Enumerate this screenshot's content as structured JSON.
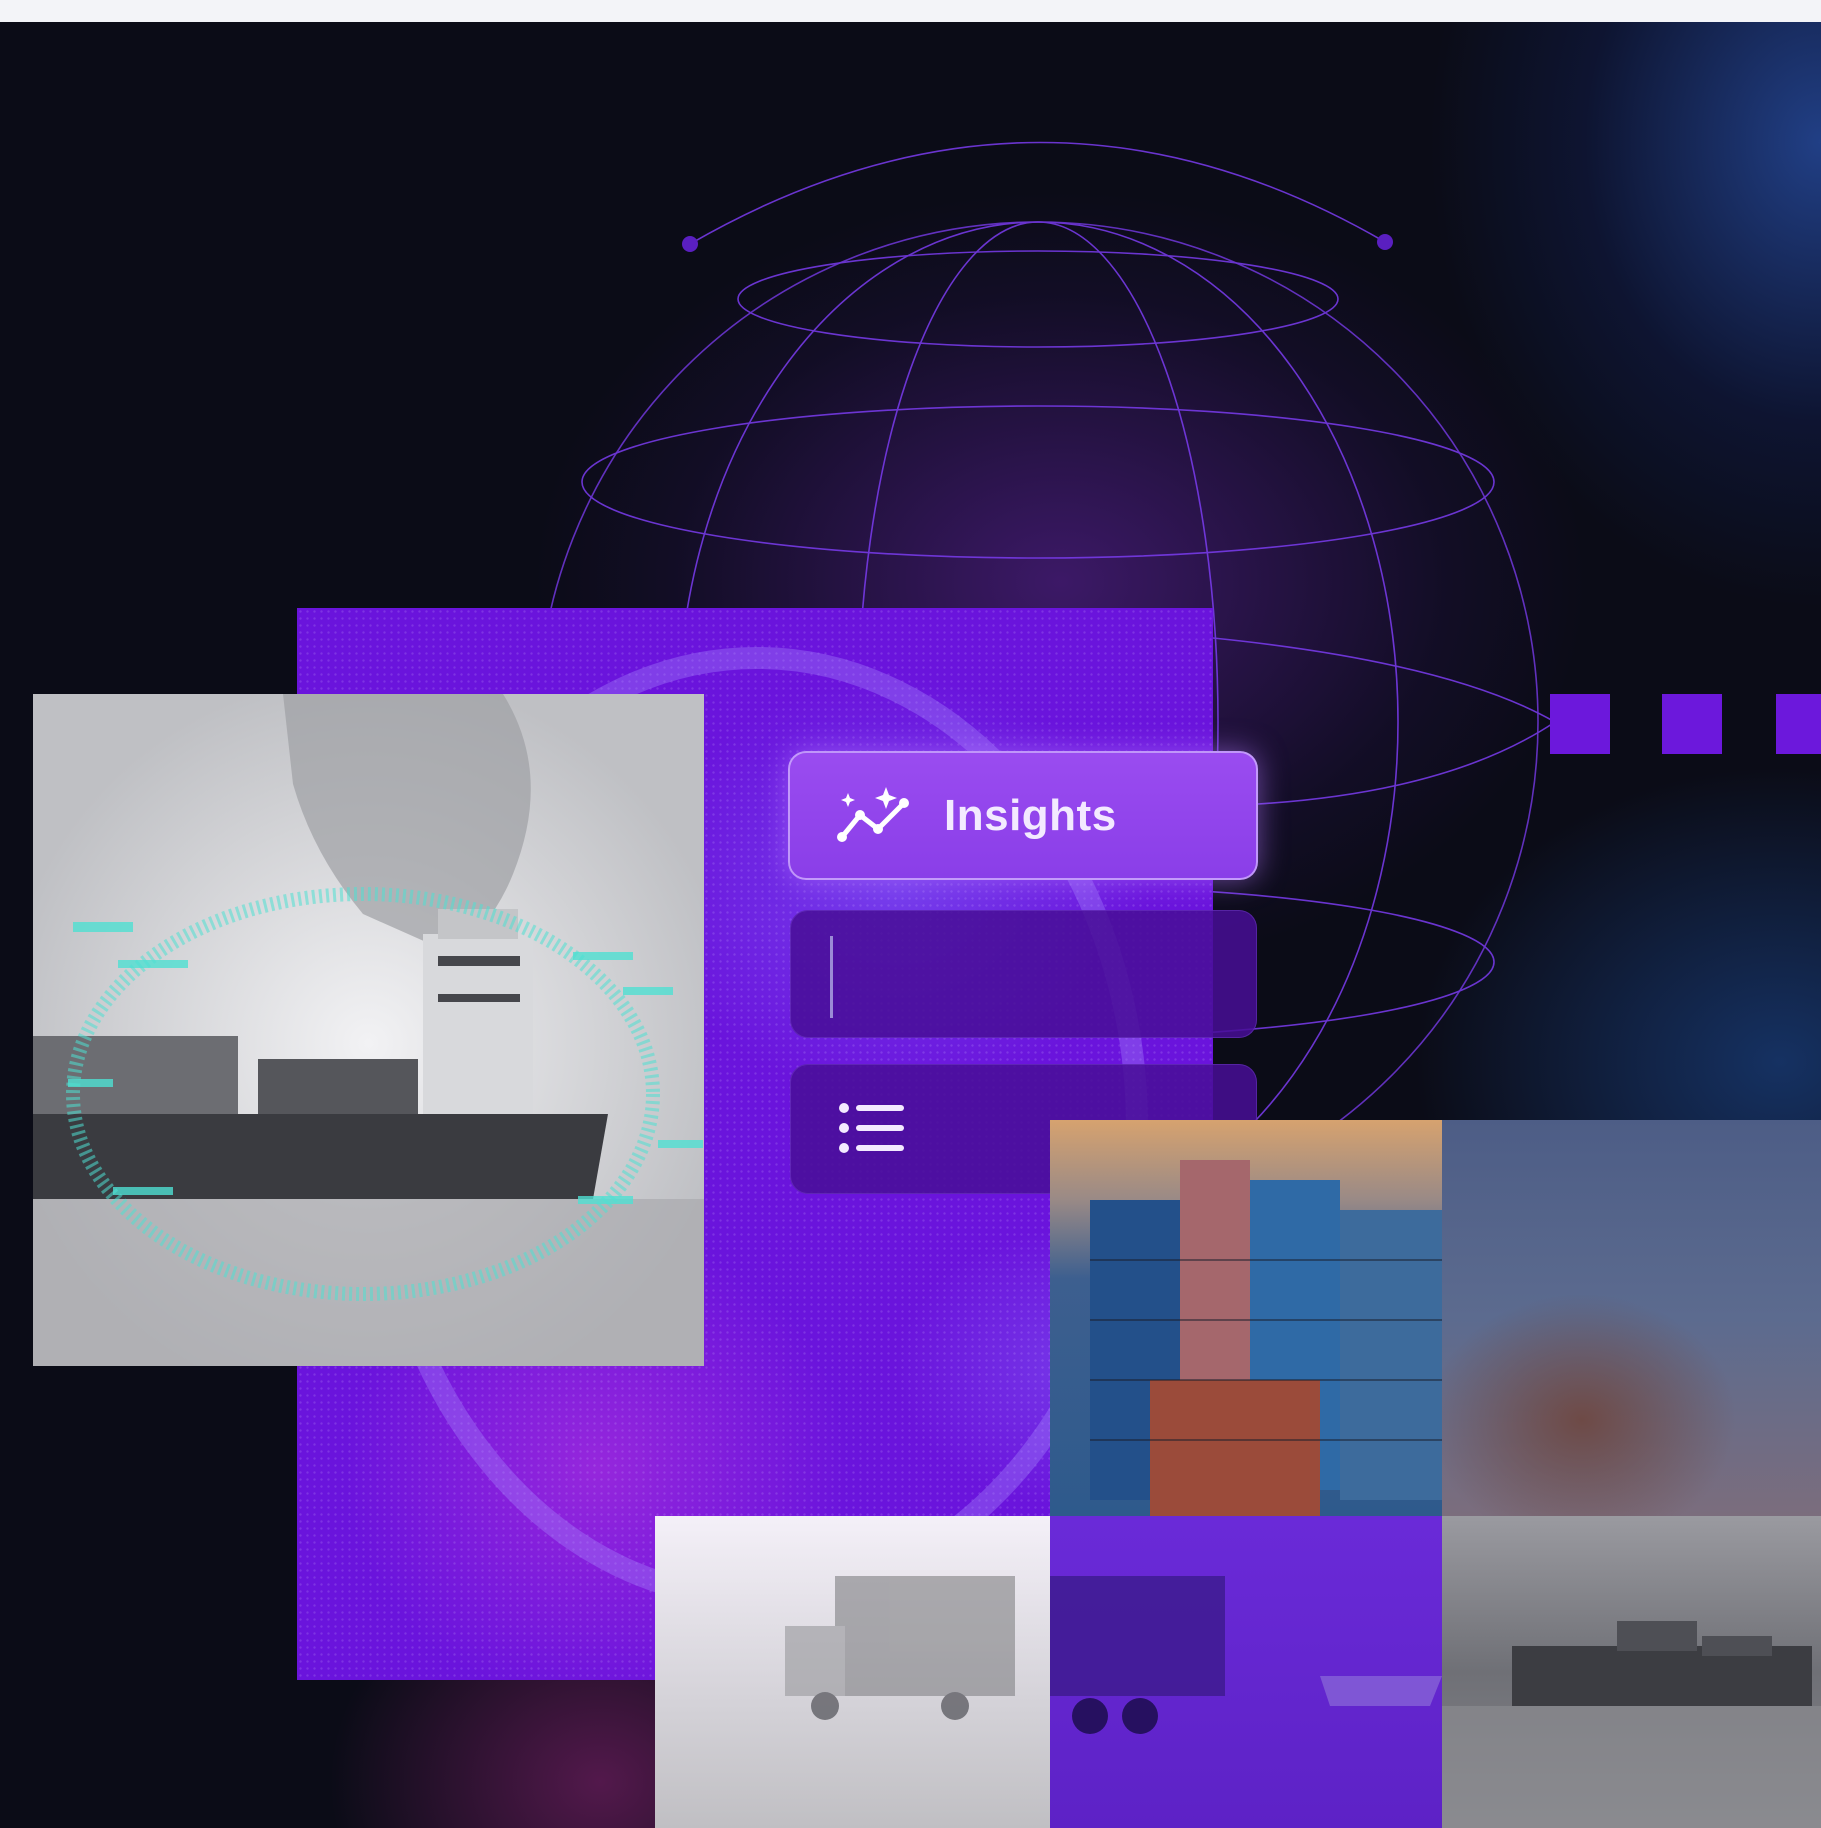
{
  "hero": {
    "insights_label": "Insights",
    "input_value": "",
    "icons": {
      "insights": "sparkle-trend-icon",
      "list": "list-icon"
    }
  },
  "colors": {
    "background": "#0b0c17",
    "panel_purple": "#6a14dc",
    "button_purple": "#9a4cf0",
    "globe_line": "#7b3cf0",
    "accent_square": "#6c18dc"
  },
  "images": [
    "cargo-ship-hologram",
    "stacked-shipping-containers",
    "blurred-port-sky",
    "blurred-truck",
    "container-trailer-purple",
    "cargo-ship-grayscale"
  ]
}
